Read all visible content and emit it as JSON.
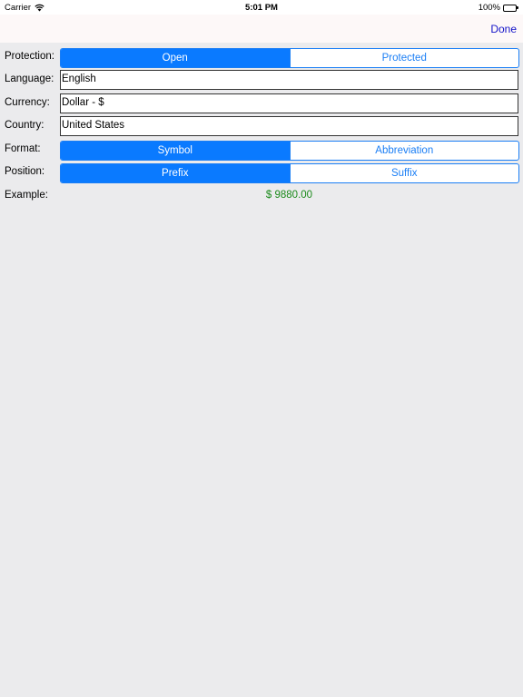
{
  "status_bar": {
    "carrier": "Carrier",
    "time": "5:01 PM",
    "battery_percent": "100%",
    "battery_level": 1.0
  },
  "nav_bar": {
    "done_label": "Done",
    "done_color": "#1515c9"
  },
  "form": {
    "protection": {
      "label": "Protection:",
      "options": [
        "Open",
        "Protected"
      ],
      "selected_index": 0
    },
    "language": {
      "label": "Language:",
      "value": "English"
    },
    "currency": {
      "label": "Currency:",
      "value": "Dollar - $"
    },
    "country": {
      "label": "Country:",
      "value": "United States"
    },
    "format": {
      "label": "Format:",
      "options": [
        "Symbol",
        "Abbreviation"
      ],
      "selected_index": 0
    },
    "position": {
      "label": "Position:",
      "options": [
        "Prefix",
        "Suffix"
      ],
      "selected_index": 0
    },
    "example": {
      "label": "Example:",
      "value": "$ 9880.00",
      "color": "#1a8a1a"
    }
  },
  "colors": {
    "accent": "#0a7aff",
    "background": "#ebebed"
  }
}
